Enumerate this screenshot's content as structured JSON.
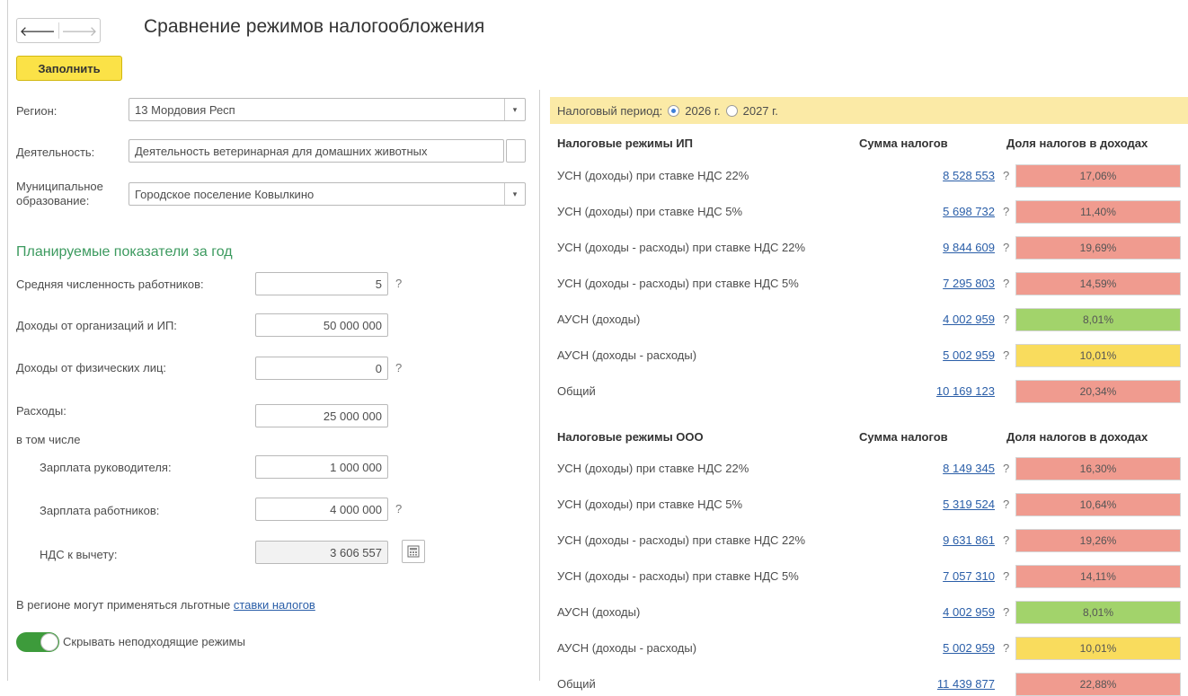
{
  "title": "Сравнение режимов налогообложения",
  "toolbar": {
    "fill_label": "Заполнить"
  },
  "form": {
    "region_label": "Регион:",
    "region_value": "13 Мордовия Респ",
    "activity_label": "Деятельность:",
    "activity_value": "Деятельность ветеринарная для домашних животных",
    "municipal_label_1": "Муниципальное",
    "municipal_label_2": "образование:",
    "municipal_value": "Городское поселение Ковылкино"
  },
  "planned": {
    "heading": "Планируемые показатели за год",
    "employees_label": "Средняя численность работников:",
    "employees_value": "5",
    "income_org_label": "Доходы от организаций и ИП:",
    "income_org_value": "50 000 000",
    "income_ind_label": "Доходы от физических лиц:",
    "income_ind_value": "0",
    "expenses_label": "Расходы:",
    "expenses_value": "25 000 000",
    "including_label": "в том числе",
    "salary_head_label": "Зарплата руководителя:",
    "salary_head_value": "1 000 000",
    "salary_staff_label": "Зарплата работников:",
    "salary_staff_value": "4 000 000",
    "vat_label": "НДС к вычету:",
    "vat_value": "3 606 557",
    "question": "?"
  },
  "note": {
    "text": "В регионе могут применяться льготные",
    "link": "ставки налогов"
  },
  "toggle": {
    "label": "Скрывать неподходящие режимы",
    "on": true
  },
  "period": {
    "label": "Налоговый период:",
    "options": [
      "2026 г.",
      "2027 г."
    ],
    "selected": "2026 г."
  },
  "ip": {
    "header": "Налоговые режимы ИП",
    "sum_header": "Сумма налогов",
    "share_header": "Доля налогов в доходах",
    "rows": [
      {
        "name": "УСН (доходы) при ставке НДС 22%",
        "amount": "8 528 553",
        "q": "?",
        "share": "17,06%",
        "level": "red"
      },
      {
        "name": "УСН (доходы) при ставке НДС 5%",
        "amount": "5 698 732",
        "q": "?",
        "share": "11,40%",
        "level": "red"
      },
      {
        "name": "УСН (доходы - расходы) при ставке НДС 22%",
        "amount": "9 844 609",
        "q": "?",
        "share": "19,69%",
        "level": "red"
      },
      {
        "name": "УСН (доходы - расходы) при ставке НДС 5%",
        "amount": "7 295 803",
        "q": "?",
        "share": "14,59%",
        "level": "red"
      },
      {
        "name": "АУСН (доходы)",
        "amount": "4 002 959",
        "q": "?",
        "share": "8,01%",
        "level": "green"
      },
      {
        "name": "АУСН (доходы - расходы)",
        "amount": "5 002 959",
        "q": "?",
        "share": "10,01%",
        "level": "yellow"
      },
      {
        "name": "Общий",
        "amount": "10 169 123",
        "q": "",
        "share": "20,34%",
        "level": "red"
      }
    ]
  },
  "ooo": {
    "header": "Налоговые режимы ООО",
    "sum_header": "Сумма налогов",
    "share_header": "Доля налогов в доходах",
    "rows": [
      {
        "name": "УСН (доходы) при ставке НДС 22%",
        "amount": "8 149 345",
        "q": "?",
        "share": "16,30%",
        "level": "red"
      },
      {
        "name": "УСН (доходы) при ставке НДС 5%",
        "amount": "5 319 524",
        "q": "?",
        "share": "10,64%",
        "level": "red"
      },
      {
        "name": "УСН (доходы - расходы) при ставке НДС 22%",
        "amount": "9 631 861",
        "q": "?",
        "share": "19,26%",
        "level": "red"
      },
      {
        "name": "УСН (доходы - расходы) при ставке НДС 5%",
        "amount": "7 057 310",
        "q": "?",
        "share": "14,11%",
        "level": "red"
      },
      {
        "name": "АУСН (доходы)",
        "amount": "4 002 959",
        "q": "?",
        "share": "8,01%",
        "level": "green"
      },
      {
        "name": "АУСН (доходы - расходы)",
        "amount": "5 002 959",
        "q": "?",
        "share": "10,01%",
        "level": "yellow"
      },
      {
        "name": "Общий",
        "amount": "11 439 877",
        "q": "",
        "share": "22,88%",
        "level": "red"
      }
    ]
  },
  "icons": {
    "back": "arrow-left-icon",
    "forward": "arrow-right-icon",
    "dropdown": "chevron-down-icon",
    "calculator": "calculator-icon"
  }
}
